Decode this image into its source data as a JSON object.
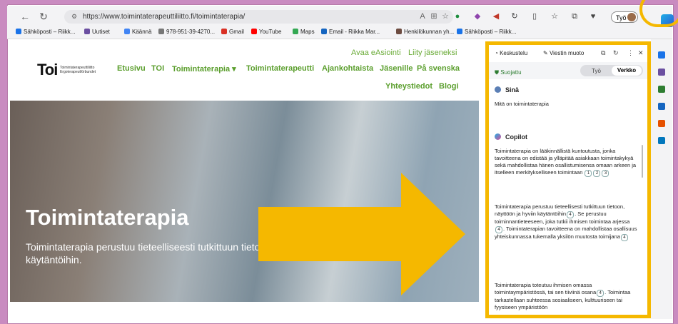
{
  "browser": {
    "url": "https://www.toimintaterapeuttiliitto.fi/toimintaterapia/",
    "profile_label": "Työ",
    "bookmarks": [
      {
        "label": "Sähköposti – Riikk...",
        "color": "#1a73e8"
      },
      {
        "label": "Uutiset",
        "color": "#6b4fa1"
      },
      {
        "label": "Käännä",
        "color": "#4285f4"
      },
      {
        "label": "978-951-39-4270...",
        "color": "#777777"
      },
      {
        "label": "Gmail",
        "color": "#d93025"
      },
      {
        "label": "YouTube",
        "color": "#ff0000"
      },
      {
        "label": "Maps",
        "color": "#34a853"
      },
      {
        "label": "Email - Riikka Mar...",
        "color": "#1565c0"
      },
      {
        "label": "Henkilökunnan yh...",
        "color": "#6d4c41"
      },
      {
        "label": "Sähköposti – Riikk...",
        "color": "#1a73e8"
      }
    ]
  },
  "site": {
    "logo": "Toi",
    "logo_sub": "Toimintaterapeuttiliitto Ergoterapeutförbundet",
    "top_links": [
      "Avaa eAsiointi",
      "Liity jäseneksi"
    ],
    "nav": [
      "Etusivu",
      "TOI",
      "Toimintaterapia ▾",
      "Toimintaterapeutti",
      "Ajankohtaista",
      "Jäsenille",
      "På svenska"
    ],
    "nav2": [
      "Yhteystiedot",
      "Blogi"
    ],
    "hero_title": "Toimintaterapia",
    "hero_text": "Toimintaterapia perustuu tieteelliseesti tutkittuun tietoon, näyttöön ja hyviin käytäntöihin."
  },
  "copilot": {
    "tab_chat": "Keskustelu",
    "tab_compose": "Viestin muoto",
    "protected": "Suojattu",
    "toggle_work": "Työ",
    "toggle_web": "Verkko",
    "user_name": "Sinä",
    "user_message": "Mitä on toimintaterapia",
    "bot_name": "Copilot",
    "p1": "Toimintaterapia on lääkinnällistä kuntoutusta, jonka tavoitteena on edistää ja ylläpitää asiakkaan toimintakykyä sekä mahdollistaa hänen osallistumisensa omaan arkeen ja itselleen merkitykselliseen toimintaan",
    "p2a": "Toimintaterapia perustuu tieteellisesti tutkittuun tietoon, näyttöön ja hyviin käytäntöihin",
    "p2b": ". Se perustuu toiminnantieteeseen, joka tutkii ihmisen toimintaa arjessa",
    "p2c": ". Toimintaterapian tavoitteena on mahdollistaa osallisuus yhteiskunnassa tukemalla yksilön muutosta toimijana",
    "p3a": "Toimintaterapia toteutuu ihmisen omassa toimintaympäristössä, tai sen tiiviinä osana",
    "p3b": ". Toimintaa tarkastellaan suhteessa sosiaaliseen, kulttuuriseen tai fyysiseen ympäristöön"
  },
  "colors": {
    "highlight": "#f5b800",
    "accent_green": "#5a9e2c"
  }
}
